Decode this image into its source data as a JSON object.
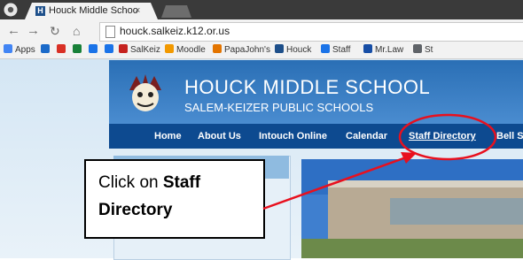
{
  "browser": {
    "tab_title": "Houck Middle Schoo",
    "tab_favicon": "H",
    "tab_close": "×",
    "url": "houck.salkeiz.k12.or.us"
  },
  "bookmarks": [
    {
      "label": "Apps",
      "color": "#4285f4"
    },
    {
      "label": "",
      "color": "#1b6ac9"
    },
    {
      "label": "",
      "color": "#d93025"
    },
    {
      "label": "",
      "color": "#188038"
    },
    {
      "label": "",
      "color": "#1a73e8"
    },
    {
      "label": "",
      "color": "#1a73e8"
    },
    {
      "label": "SalKeiz",
      "color": "#c5221f"
    },
    {
      "label": "Moodle",
      "color": "#f29900"
    },
    {
      "label": "PapaJohn's",
      "color": "#e37400"
    },
    {
      "label": "Houck",
      "color": "#1d4f8a"
    },
    {
      "label": "Staff",
      "color": "#1a73e8"
    },
    {
      "label": "Mr.Law",
      "color": "#174ea6"
    },
    {
      "label": "St",
      "color": "#5f6368"
    }
  ],
  "site": {
    "school_name": "HOUCK MIDDLE SCHOOL",
    "district": "SALEM-KEIZER PUBLIC SCHOOLS",
    "nav": [
      "Home",
      "About Us",
      "Intouch Online",
      "Calendar",
      "Staff Directory",
      "Bell S"
    ]
  },
  "callout": {
    "prefix": "Click on ",
    "bold1": "Staff",
    "bold2": "Directory"
  },
  "colors": {
    "banner": "#3a7fc4",
    "navbar": "#0d4a90",
    "annotation": "#e8101e"
  }
}
